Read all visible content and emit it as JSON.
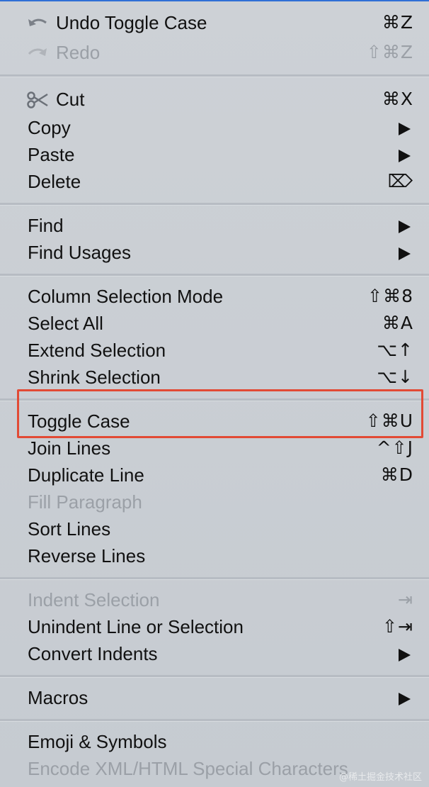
{
  "menu": {
    "undo": {
      "label": "Undo Toggle Case",
      "shortcut": "⌘Z",
      "icon": "undo-arrow-icon"
    },
    "redo": {
      "label": "Redo",
      "shortcut": "⇧⌘Z",
      "icon": "redo-arrow-icon"
    },
    "cut": {
      "label": "Cut",
      "shortcut": "⌘X",
      "icon": "scissors-icon"
    },
    "copy": {
      "label": "Copy"
    },
    "paste": {
      "label": "Paste"
    },
    "delete": {
      "label": "Delete",
      "shortcut": "⌦"
    },
    "find": {
      "label": "Find"
    },
    "find_usages": {
      "label": "Find Usages"
    },
    "column_selection": {
      "label": "Column Selection Mode",
      "shortcut": "⇧⌘8"
    },
    "select_all": {
      "label": "Select All",
      "shortcut": "⌘A"
    },
    "extend_selection": {
      "label": "Extend Selection",
      "shortcut": "⌥↑"
    },
    "shrink_selection": {
      "label": "Shrink Selection",
      "shortcut": "⌥↓"
    },
    "toggle_case": {
      "label": "Toggle Case",
      "shortcut": "⇧⌘U"
    },
    "join_lines": {
      "label": "Join Lines",
      "shortcut": "^⇧J"
    },
    "duplicate_line": {
      "label": "Duplicate Line",
      "shortcut": "⌘D"
    },
    "fill_paragraph": {
      "label": "Fill Paragraph"
    },
    "sort_lines": {
      "label": "Sort Lines"
    },
    "reverse_lines": {
      "label": "Reverse Lines"
    },
    "indent_selection": {
      "label": "Indent Selection",
      "shortcut": "⇥"
    },
    "unindent": {
      "label": "Unindent Line or Selection",
      "shortcut": "⇧⇥"
    },
    "convert_indents": {
      "label": "Convert Indents"
    },
    "macros": {
      "label": "Macros"
    },
    "emoji": {
      "label": "Emoji & Symbols"
    },
    "encode_xml": {
      "label": "Encode XML/HTML Special Characters"
    }
  },
  "colors": {
    "highlight_border": "#e24a35",
    "disabled_text": "#9ba0a7",
    "menu_background": "#c9ced4"
  },
  "watermark": "@稀土掘金技术社区"
}
